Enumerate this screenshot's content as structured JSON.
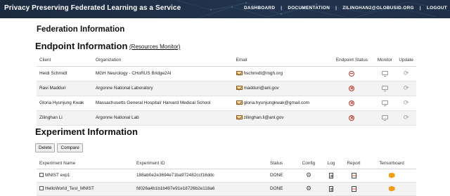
{
  "navbar": {
    "brand": "Privacy Preserving Federated Learning as a Service",
    "links": [
      "DASHBOARD",
      "DOCUMENTATION",
      "ZILINGHAN2@GLOBUSID.ORG",
      "LOGOUT"
    ]
  },
  "federation": {
    "title": "Federation Information"
  },
  "endpoint": {
    "title": "Endpoint Information",
    "resources_link": "(Resources Monitor)",
    "columns": [
      "Client",
      "Organization",
      "Email",
      "Endpoint Status",
      "Monitor",
      "Update"
    ],
    "rows": [
      {
        "client": "Heidi Schmidt",
        "organization": "MGH Neurology - CHoRUS Bridge2AI",
        "email": "hschmidt@mgh.org",
        "status_icon": "minus-circle-icon"
      },
      {
        "client": "Ravi Madduri",
        "organization": "Argonne National Laboratory",
        "email": "madduri@anl.gov",
        "status_icon": "x-circle-icon"
      },
      {
        "client": "Gloria Hyunjung Kwak",
        "organization": "Massachusetts General Hospital/ Harvard Medical School",
        "email": "gloria.hyunjungkwak@gmail.com",
        "status_icon": "x-circle-icon"
      },
      {
        "client": "Zilinghan Li",
        "organization": "Argonne National Lab",
        "email": "zilinghan.li@anl.gov",
        "status_icon": "x-circle-icon"
      }
    ]
  },
  "experiment": {
    "title": "Experiment Information",
    "buttons": {
      "delete": "Delete",
      "compare": "Compare"
    },
    "columns": [
      "Experiment Name",
      "Experiment ID",
      "Status",
      "Config",
      "Log",
      "Report",
      "Tensorboard"
    ],
    "rows": [
      {
        "name": "MNIST exp1",
        "id": "188ab0e2e3694e71ba972482ccf16ddc",
        "status": "DONE"
      },
      {
        "name": "HelloWorld_Test_MNIST",
        "id": "fd026a4b1b1b497e91e18726b2e118a6",
        "status": "DONE"
      }
    ]
  },
  "colors": {
    "navbar": "#1c2b40",
    "status_icon": "#c0392b",
    "tensorboard_icon": "#f39c12"
  }
}
